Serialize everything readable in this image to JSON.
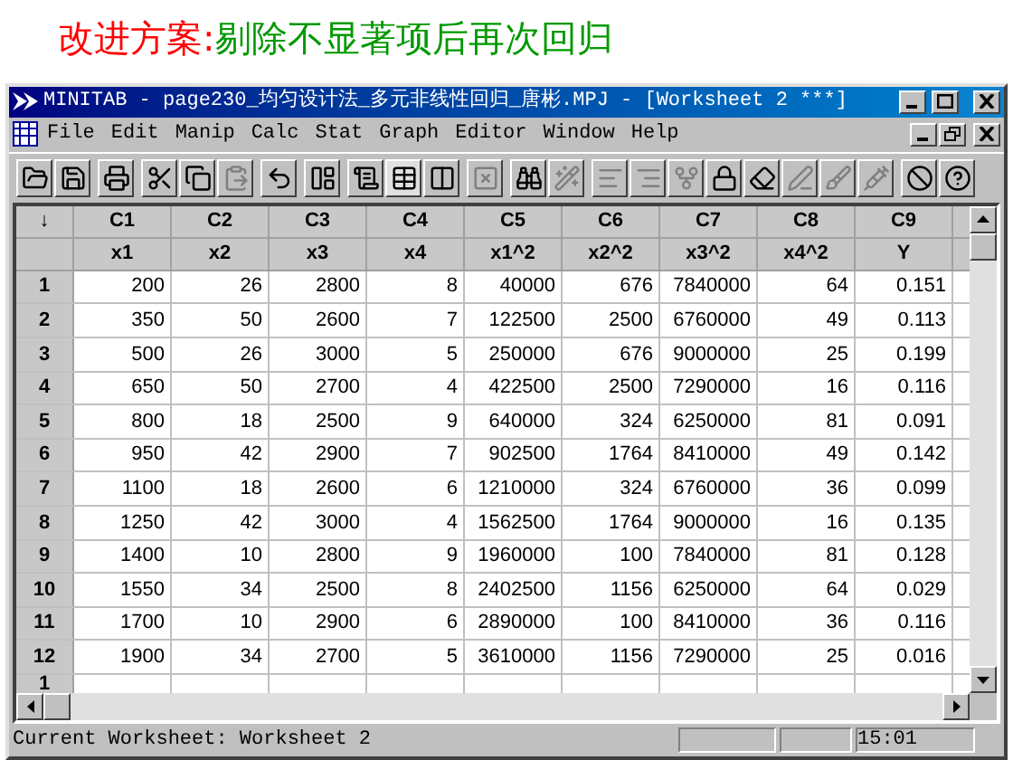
{
  "slide_title": {
    "label": "改进方案:",
    "text": "剔除不显著项后再次回归"
  },
  "window": {
    "title": "MINITAB - page230_均匀设计法_多元非线性回归_唐彬.MPJ - [Worksheet 2 ***]"
  },
  "menu": [
    "File",
    "Edit",
    "Manip",
    "Calc",
    "Stat",
    "Graph",
    "Editor",
    "Window",
    "Help"
  ],
  "table": {
    "corner": "↓",
    "columns": [
      {
        "id": "C1",
        "name": "x1"
      },
      {
        "id": "C2",
        "name": "x2"
      },
      {
        "id": "C3",
        "name": "x3"
      },
      {
        "id": "C4",
        "name": "x4"
      },
      {
        "id": "C5",
        "name": "x1^2"
      },
      {
        "id": "C6",
        "name": "x2^2"
      },
      {
        "id": "C7",
        "name": "x3^2"
      },
      {
        "id": "C8",
        "name": "x4^2"
      },
      {
        "id": "C9",
        "name": "Y"
      }
    ],
    "rows": [
      {
        "label": "1",
        "cells": [
          "200",
          "26",
          "2800",
          "8",
          "40000",
          "676",
          "7840000",
          "64",
          "0.151"
        ]
      },
      {
        "label": "2",
        "cells": [
          "350",
          "50",
          "2600",
          "7",
          "122500",
          "2500",
          "6760000",
          "49",
          "0.113"
        ]
      },
      {
        "label": "3",
        "cells": [
          "500",
          "26",
          "3000",
          "5",
          "250000",
          "676",
          "9000000",
          "25",
          "0.199"
        ]
      },
      {
        "label": "4",
        "cells": [
          "650",
          "50",
          "2700",
          "4",
          "422500",
          "2500",
          "7290000",
          "16",
          "0.116"
        ]
      },
      {
        "label": "5",
        "cells": [
          "800",
          "18",
          "2500",
          "9",
          "640000",
          "324",
          "6250000",
          "81",
          "0.091"
        ]
      },
      {
        "label": "6",
        "cells": [
          "950",
          "42",
          "2900",
          "7",
          "902500",
          "1764",
          "8410000",
          "49",
          "0.142"
        ]
      },
      {
        "label": "7",
        "cells": [
          "1100",
          "18",
          "2600",
          "6",
          "1210000",
          "324",
          "6760000",
          "36",
          "0.099"
        ]
      },
      {
        "label": "8",
        "cells": [
          "1250",
          "42",
          "3000",
          "4",
          "1562500",
          "1764",
          "9000000",
          "16",
          "0.135"
        ]
      },
      {
        "label": "9",
        "cells": [
          "1400",
          "10",
          "2800",
          "9",
          "1960000",
          "100",
          "7840000",
          "81",
          "0.128"
        ]
      },
      {
        "label": "10",
        "cells": [
          "1550",
          "34",
          "2500",
          "8",
          "2402500",
          "1156",
          "6250000",
          "64",
          "0.029"
        ]
      },
      {
        "label": "11",
        "cells": [
          "1700",
          "10",
          "2900",
          "6",
          "2890000",
          "100",
          "8410000",
          "36",
          "0.116"
        ]
      },
      {
        "label": "12",
        "cells": [
          "1900",
          "34",
          "2700",
          "5",
          "3610000",
          "1156",
          "7290000",
          "25",
          "0.016"
        ]
      }
    ],
    "partial_row": {
      "label": "1"
    }
  },
  "status_bar": {
    "text": "Current Worksheet: Worksheet 2",
    "time": "15:01"
  }
}
